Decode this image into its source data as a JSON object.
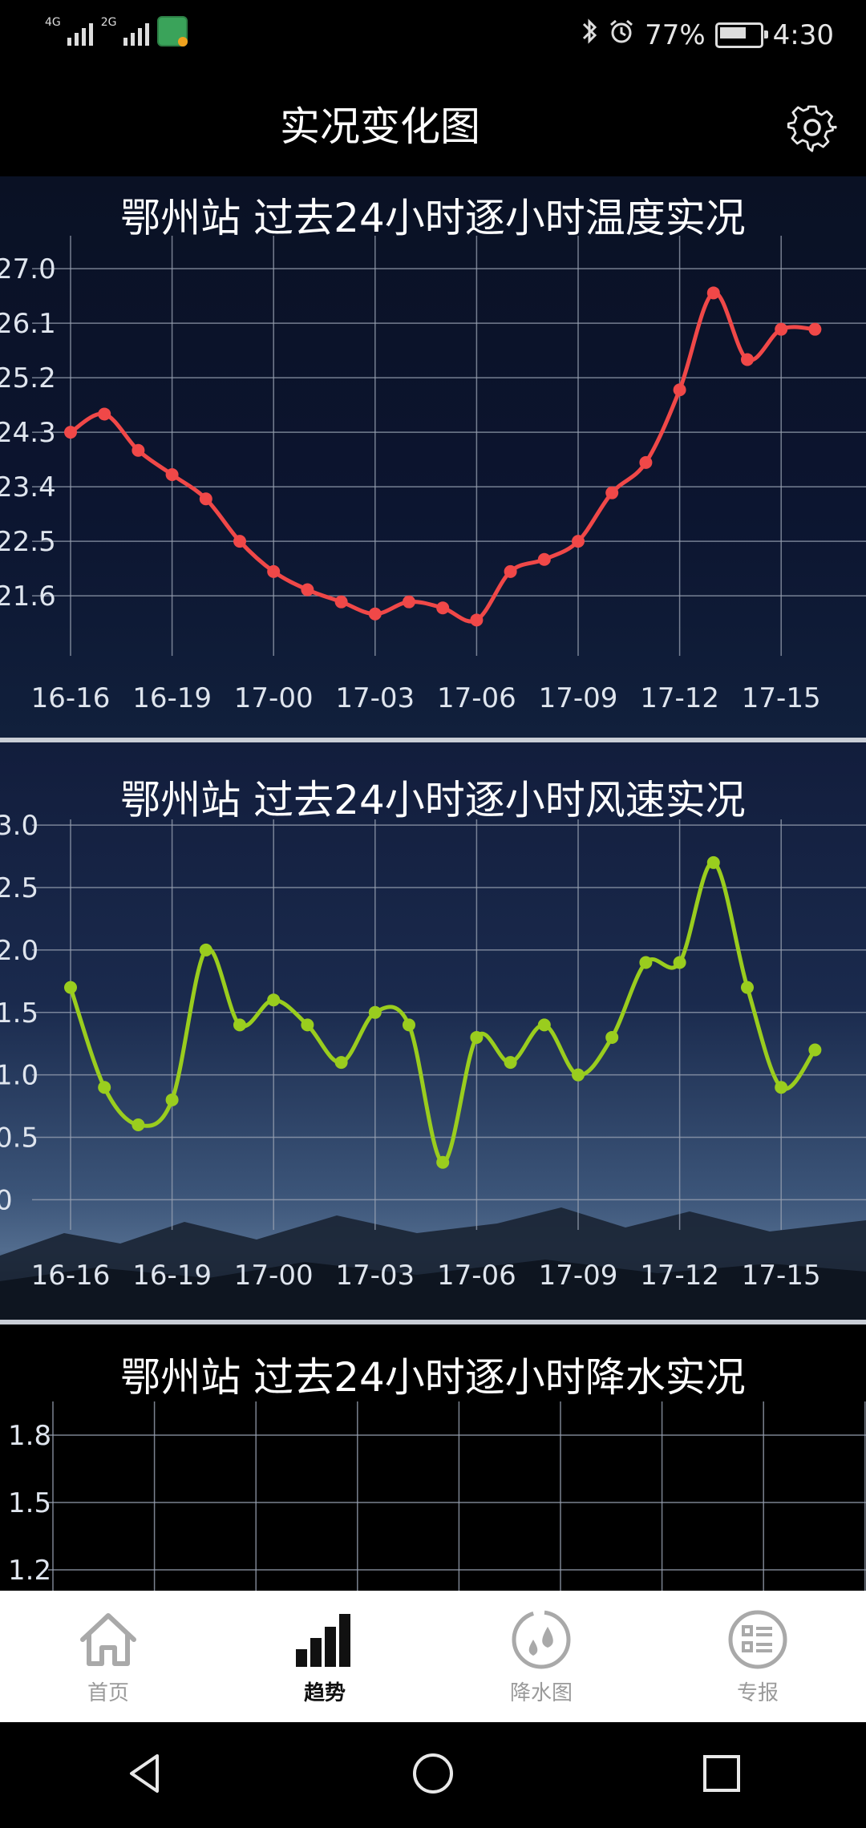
{
  "status_bar": {
    "network1": "4G",
    "network2": "2G",
    "battery": "77%",
    "battery_level": 0.77,
    "time": "4:30"
  },
  "header": {
    "title": "实况变化图"
  },
  "charts": {
    "temperature": {
      "title": "鄂州站 过去24小时逐小时温度实况"
    },
    "wind": {
      "title": "鄂州站 过去24小时逐小时风速实况"
    },
    "rain": {
      "title": "鄂州站 过去24小时逐小时降水实况"
    }
  },
  "chart_data": [
    {
      "type": "line",
      "title": "鄂州站 过去24小时逐小时温度实况",
      "color": "#f04848",
      "x_labels": [
        "16-16",
        "16-19",
        "17-00",
        "17-03",
        "17-06",
        "17-09",
        "17-12",
        "17-15"
      ],
      "y_ticks": [
        "27.0",
        "26.1",
        "25.2",
        "24.3",
        "23.4",
        "22.5",
        "21.6"
      ],
      "ylim": [
        20.9,
        27.2
      ],
      "x": [
        0,
        1,
        2,
        3,
        4,
        5,
        6,
        7,
        8,
        9,
        10,
        11,
        12,
        13,
        14,
        15,
        16,
        17,
        18,
        19,
        20,
        21,
        22
      ],
      "values": [
        24.3,
        24.6,
        24.0,
        23.6,
        23.2,
        22.5,
        22.0,
        21.7,
        21.5,
        21.3,
        21.5,
        21.4,
        21.2,
        22.0,
        22.2,
        22.5,
        23.3,
        23.8,
        25.0,
        26.6,
        25.5,
        26.0,
        26.0
      ]
    },
    {
      "type": "line",
      "title": "鄂州站 过去24小时逐小时风速实况",
      "color": "#9acd1e",
      "x_labels": [
        "16-16",
        "16-19",
        "17-00",
        "17-03",
        "17-06",
        "17-09",
        "17-12",
        "17-15"
      ],
      "y_ticks": [
        "3.0",
        "2.5",
        "2.0",
        "1.5",
        "1.0",
        "0.5",
        "0"
      ],
      "ylim": [
        -0.1,
        3.2
      ],
      "x": [
        0,
        1,
        2,
        3,
        4,
        5,
        6,
        7,
        8,
        9,
        10,
        11,
        12,
        13,
        14,
        15,
        16,
        17,
        18,
        19,
        20,
        21,
        22
      ],
      "values": [
        1.7,
        0.9,
        0.6,
        0.8,
        2.0,
        1.4,
        1.6,
        1.4,
        1.1,
        1.5,
        1.4,
        0.3,
        1.3,
        1.1,
        1.4,
        1.0,
        1.3,
        1.9,
        1.9,
        2.7,
        1.7,
        0.9,
        1.2
      ]
    },
    {
      "type": "line",
      "title": "鄂州站 过去24小时逐小时降水实况",
      "y_ticks": [
        "1.8",
        "1.5",
        "1.2"
      ],
      "values": []
    }
  ],
  "bottom_nav": [
    {
      "label": "首页",
      "icon": "home-icon",
      "active": false
    },
    {
      "label": "趋势",
      "icon": "trend-bars-icon",
      "active": true
    },
    {
      "label": "降水图",
      "icon": "rain-drops-icon",
      "active": false
    },
    {
      "label": "专报",
      "icon": "report-list-icon",
      "active": false
    }
  ]
}
